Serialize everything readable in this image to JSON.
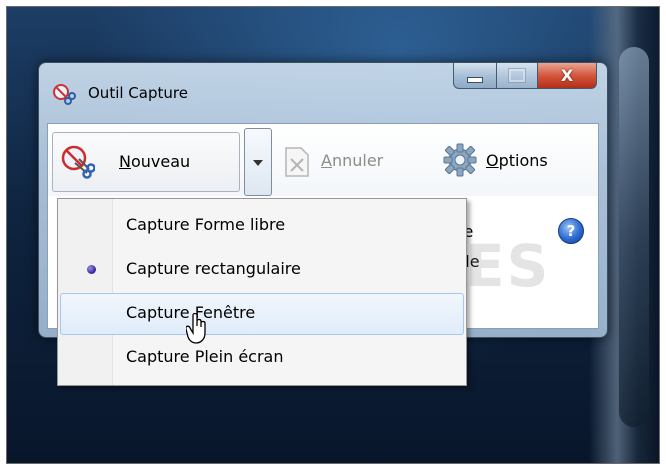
{
  "window": {
    "title": "Outil Capture",
    "close_glyph": "X"
  },
  "toolbar": {
    "new_label": "Nouveau",
    "cancel_label": "Annuler",
    "options_label": "Options"
  },
  "background_text": {
    "line1_suffix": "le",
    "line2_suffix": "elle",
    "help_glyph": "?"
  },
  "watermark": {
    "text": "PCASTUCES"
  },
  "menu": {
    "items": [
      {
        "label": "Capture Forme libre",
        "selected": false,
        "hover": false
      },
      {
        "label": "Capture rectangulaire",
        "selected": true,
        "hover": false
      },
      {
        "label": "Capture Fenêtre",
        "selected": false,
        "hover": true
      },
      {
        "label": "Capture Plein écran",
        "selected": false,
        "hover": false
      }
    ]
  },
  "colors": {
    "title_bar": "#b0c7de",
    "close_button": "#d4573d",
    "menu_hover_border": "#a8c7ee",
    "selected_bullet": "#2c1f9a"
  },
  "icons": {
    "app": "scissors-icon",
    "new": "scissors-new-icon",
    "cancel": "cancel-document-icon",
    "options": "gear-icon",
    "help": "help-icon",
    "dropdown": "chevron-down-icon"
  }
}
